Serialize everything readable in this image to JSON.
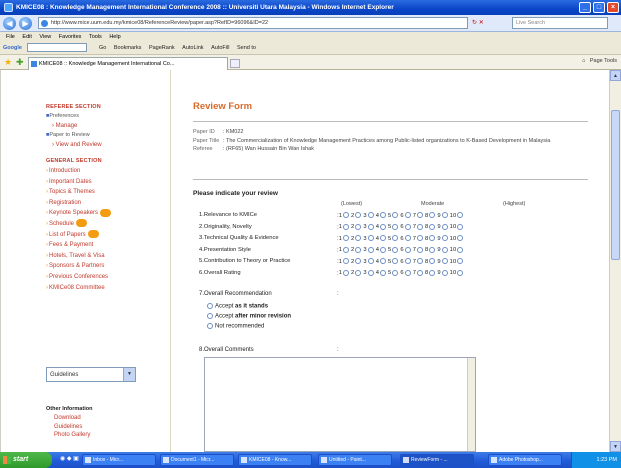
{
  "window": {
    "title": "KMICE08 : Knowledge Management International Conference 2008 :: Universiti Utara Malaysia - Windows Internet Explorer"
  },
  "address_bar": {
    "url": "http://www.mice.uum.edu.my/kmice08/ReferenceReview/paper.asp?RefID=96096&ID=22",
    "search_placeholder": "Live Search"
  },
  "menu": [
    "File",
    "Edit",
    "View",
    "Favorites",
    "Tools",
    "Help"
  ],
  "google_bar": {
    "label": "Google",
    "items": [
      "Go",
      "Bookmarks",
      "PageRank",
      "AutoLink",
      "AutoFill",
      "Send to"
    ]
  },
  "tab": {
    "label": "KMICE08 :: Knowledge Management International Co...",
    "commands": "Page  Tools"
  },
  "sidebar": {
    "reviewer_heading": "REFEREE SECTION",
    "preferences": "Preferences",
    "manage": "Manage",
    "paper_review": "Paper to Review",
    "view_review": "View and Review",
    "general_heading": "GENERAL SECTION",
    "items": [
      {
        "label": "Introduction",
        "badge": false
      },
      {
        "label": "Important Dates",
        "badge": false
      },
      {
        "label": "Topics & Themes",
        "badge": false
      },
      {
        "label": "Registration",
        "badge": false
      },
      {
        "label": "Keynote Speakers",
        "badge": true
      },
      {
        "label": "Schedule",
        "badge": true
      },
      {
        "label": "List of Papers",
        "badge": true
      },
      {
        "label": "Fees & Payment",
        "badge": false
      },
      {
        "label": "Hotels, Travel & Visa",
        "badge": false
      },
      {
        "label": "Sponsors & Partners",
        "badge": false
      },
      {
        "label": "Previous Conferences",
        "badge": false
      },
      {
        "label": "KMICe08 Committee",
        "badge": false
      }
    ],
    "select_value": "Guidelines",
    "other_heading": "Other Information",
    "other_links": [
      "Download",
      "Guidelines",
      "Photo Gallery"
    ]
  },
  "form": {
    "title": "Review Form",
    "paper_id_label": "Paper ID",
    "paper_id": ": KM022",
    "paper_title_label": "Paper Title",
    "paper_title": ": The Commercialization of Knowledge Management Practices among Public-listed organizations to K-Based Development in Malaysia",
    "referee_label": "Referee",
    "referee": ": (RF65) Wan Hussain Bin Wan Ishak",
    "indicate": "Please indicate your review",
    "scale_lowest": "(Lowest)",
    "scale_moderate": "Moderate",
    "scale_highest": "(Highest)",
    "criteria": [
      "1.Relevance to KMICe",
      "2.Originality, Novelty",
      "3.Technical Quality & Evidence",
      "4.Presentation Style",
      "5.Contribution to Theory or Practice",
      "6.Overall Rating"
    ],
    "rating_numbers": [
      "1",
      "2",
      "3",
      "4",
      "5",
      "6",
      "7",
      "8",
      "9",
      "10"
    ],
    "recommendation_label": "7.Overall Recommendation",
    "recommendations": [
      {
        "prefix": "Accept",
        "bold": "as it stands",
        "suffix": ""
      },
      {
        "prefix": "Accept",
        "bold": "after minor revision",
        "suffix": ""
      },
      {
        "prefix": "Not recommended",
        "bold": "",
        "suffix": ""
      }
    ],
    "comments_label": "8.Overall Comments"
  },
  "taskbar": {
    "start": "start",
    "tasks": [
      "Inbox - Micr...",
      "Document1 - Micr...",
      "KMICE08 - Know...",
      "Untitled - Paint...",
      "ReviewForm - ...",
      "Adobe Photoshop..."
    ],
    "clock": "1:23 PM"
  }
}
